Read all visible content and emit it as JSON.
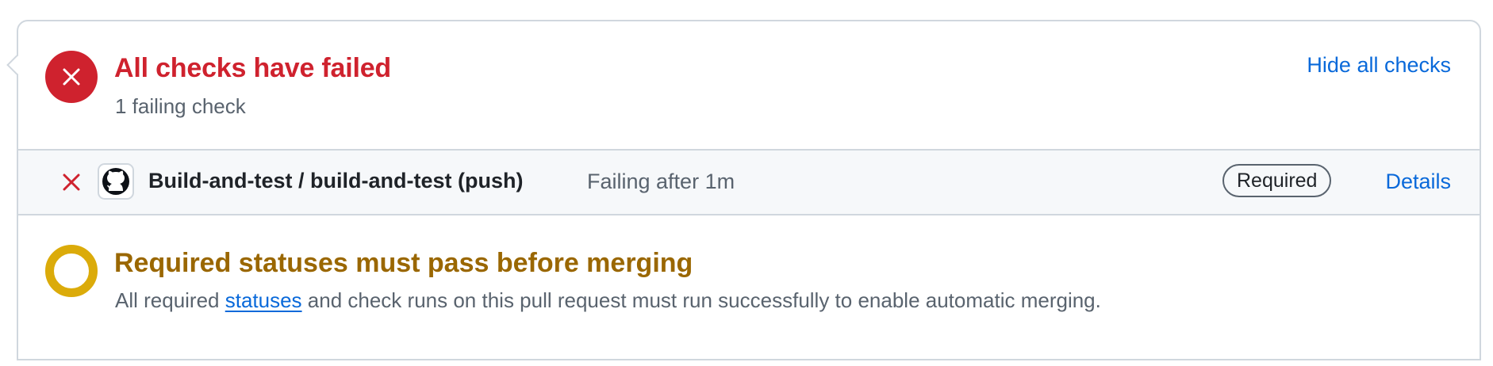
{
  "summary": {
    "title": "All checks have failed",
    "subtitle": "1 failing check",
    "hide_link": "Hide all checks",
    "status_color": "#cf222e"
  },
  "checks": [
    {
      "icon": "close-icon",
      "app_icon": "github-icon",
      "name": "Build-and-test / build-and-test (push)",
      "status": "Failing after 1m",
      "badge": "Required",
      "details_link": "Details"
    }
  ],
  "merge_requirement": {
    "title": "Required statuses must pass before merging",
    "desc_before": "All required ",
    "desc_link": "statuses",
    "desc_after": " and check runs on this pull request must run successfully to enable automatic merging.",
    "status_color": "#dbab0a"
  },
  "colors": {
    "danger": "#cf222e",
    "attention": "#9a6700",
    "link": "#0969da",
    "muted": "#59636e",
    "border": "#d0d7de"
  }
}
